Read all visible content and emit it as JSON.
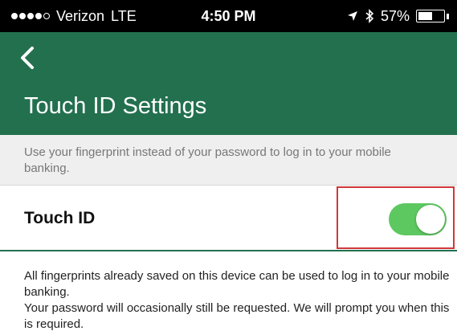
{
  "status_bar": {
    "carrier": "Verizon",
    "network": "LTE",
    "time": "4:50 PM",
    "battery": "57%",
    "battery_level": 0.57,
    "signal_bars_filled": 4,
    "signal_bars_total": 5,
    "icons": [
      "location-arrow-icon",
      "bluetooth-icon",
      "battery-icon"
    ]
  },
  "nav": {
    "back_icon": "chevron-left-icon",
    "title": "Touch ID Settings"
  },
  "description": "Use your fingerprint instead of your password to log in to your mobile banking.",
  "touch_id_row": {
    "label": "Touch ID",
    "enabled": true
  },
  "info": {
    "line1": "All fingerprints already saved on this device can be used to log in to your mobile banking.",
    "line2": "Your password will occasionally still be requested. We will prompt you when this is required."
  },
  "colors": {
    "brand_green": "#23704f",
    "toggle_on": "#5dc85f",
    "highlight_red": "#d0373a"
  }
}
